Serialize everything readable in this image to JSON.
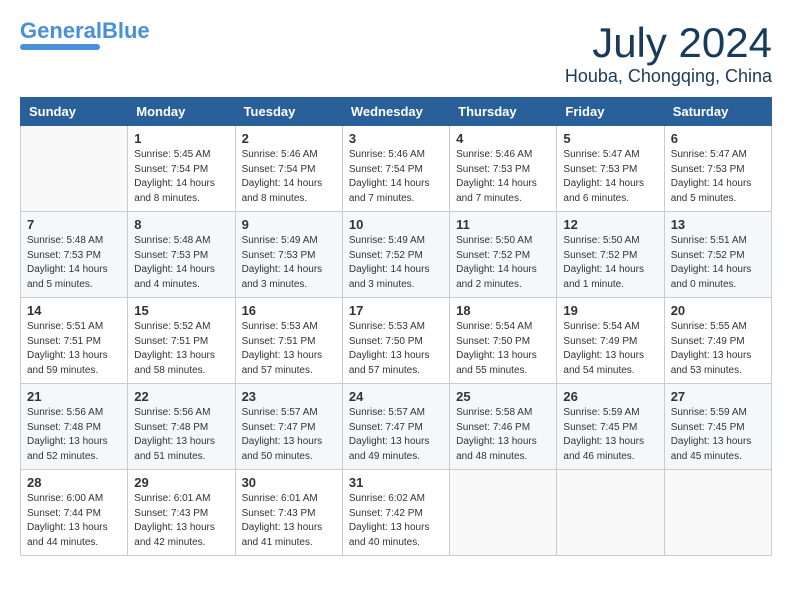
{
  "logo": {
    "line1": "General",
    "line2": "Blue",
    "tagline": ""
  },
  "title": "July 2024",
  "location": "Houba, Chongqing, China",
  "days_header": [
    "Sunday",
    "Monday",
    "Tuesday",
    "Wednesday",
    "Thursday",
    "Friday",
    "Saturday"
  ],
  "weeks": [
    [
      {
        "num": "",
        "info": ""
      },
      {
        "num": "1",
        "info": "Sunrise: 5:45 AM\nSunset: 7:54 PM\nDaylight: 14 hours\nand 8 minutes."
      },
      {
        "num": "2",
        "info": "Sunrise: 5:46 AM\nSunset: 7:54 PM\nDaylight: 14 hours\nand 8 minutes."
      },
      {
        "num": "3",
        "info": "Sunrise: 5:46 AM\nSunset: 7:54 PM\nDaylight: 14 hours\nand 7 minutes."
      },
      {
        "num": "4",
        "info": "Sunrise: 5:46 AM\nSunset: 7:53 PM\nDaylight: 14 hours\nand 7 minutes."
      },
      {
        "num": "5",
        "info": "Sunrise: 5:47 AM\nSunset: 7:53 PM\nDaylight: 14 hours\nand 6 minutes."
      },
      {
        "num": "6",
        "info": "Sunrise: 5:47 AM\nSunset: 7:53 PM\nDaylight: 14 hours\nand 5 minutes."
      }
    ],
    [
      {
        "num": "7",
        "info": "Sunrise: 5:48 AM\nSunset: 7:53 PM\nDaylight: 14 hours\nand 5 minutes."
      },
      {
        "num": "8",
        "info": "Sunrise: 5:48 AM\nSunset: 7:53 PM\nDaylight: 14 hours\nand 4 minutes."
      },
      {
        "num": "9",
        "info": "Sunrise: 5:49 AM\nSunset: 7:53 PM\nDaylight: 14 hours\nand 3 minutes."
      },
      {
        "num": "10",
        "info": "Sunrise: 5:49 AM\nSunset: 7:52 PM\nDaylight: 14 hours\nand 3 minutes."
      },
      {
        "num": "11",
        "info": "Sunrise: 5:50 AM\nSunset: 7:52 PM\nDaylight: 14 hours\nand 2 minutes."
      },
      {
        "num": "12",
        "info": "Sunrise: 5:50 AM\nSunset: 7:52 PM\nDaylight: 14 hours\nand 1 minute."
      },
      {
        "num": "13",
        "info": "Sunrise: 5:51 AM\nSunset: 7:52 PM\nDaylight: 14 hours\nand 0 minutes."
      }
    ],
    [
      {
        "num": "14",
        "info": "Sunrise: 5:51 AM\nSunset: 7:51 PM\nDaylight: 13 hours\nand 59 minutes."
      },
      {
        "num": "15",
        "info": "Sunrise: 5:52 AM\nSunset: 7:51 PM\nDaylight: 13 hours\nand 58 minutes."
      },
      {
        "num": "16",
        "info": "Sunrise: 5:53 AM\nSunset: 7:51 PM\nDaylight: 13 hours\nand 57 minutes."
      },
      {
        "num": "17",
        "info": "Sunrise: 5:53 AM\nSunset: 7:50 PM\nDaylight: 13 hours\nand 57 minutes."
      },
      {
        "num": "18",
        "info": "Sunrise: 5:54 AM\nSunset: 7:50 PM\nDaylight: 13 hours\nand 55 minutes."
      },
      {
        "num": "19",
        "info": "Sunrise: 5:54 AM\nSunset: 7:49 PM\nDaylight: 13 hours\nand 54 minutes."
      },
      {
        "num": "20",
        "info": "Sunrise: 5:55 AM\nSunset: 7:49 PM\nDaylight: 13 hours\nand 53 minutes."
      }
    ],
    [
      {
        "num": "21",
        "info": "Sunrise: 5:56 AM\nSunset: 7:48 PM\nDaylight: 13 hours\nand 52 minutes."
      },
      {
        "num": "22",
        "info": "Sunrise: 5:56 AM\nSunset: 7:48 PM\nDaylight: 13 hours\nand 51 minutes."
      },
      {
        "num": "23",
        "info": "Sunrise: 5:57 AM\nSunset: 7:47 PM\nDaylight: 13 hours\nand 50 minutes."
      },
      {
        "num": "24",
        "info": "Sunrise: 5:57 AM\nSunset: 7:47 PM\nDaylight: 13 hours\nand 49 minutes."
      },
      {
        "num": "25",
        "info": "Sunrise: 5:58 AM\nSunset: 7:46 PM\nDaylight: 13 hours\nand 48 minutes."
      },
      {
        "num": "26",
        "info": "Sunrise: 5:59 AM\nSunset: 7:45 PM\nDaylight: 13 hours\nand 46 minutes."
      },
      {
        "num": "27",
        "info": "Sunrise: 5:59 AM\nSunset: 7:45 PM\nDaylight: 13 hours\nand 45 minutes."
      }
    ],
    [
      {
        "num": "28",
        "info": "Sunrise: 6:00 AM\nSunset: 7:44 PM\nDaylight: 13 hours\nand 44 minutes."
      },
      {
        "num": "29",
        "info": "Sunrise: 6:01 AM\nSunset: 7:43 PM\nDaylight: 13 hours\nand 42 minutes."
      },
      {
        "num": "30",
        "info": "Sunrise: 6:01 AM\nSunset: 7:43 PM\nDaylight: 13 hours\nand 41 minutes."
      },
      {
        "num": "31",
        "info": "Sunrise: 6:02 AM\nSunset: 7:42 PM\nDaylight: 13 hours\nand 40 minutes."
      },
      {
        "num": "",
        "info": ""
      },
      {
        "num": "",
        "info": ""
      },
      {
        "num": "",
        "info": ""
      }
    ]
  ]
}
